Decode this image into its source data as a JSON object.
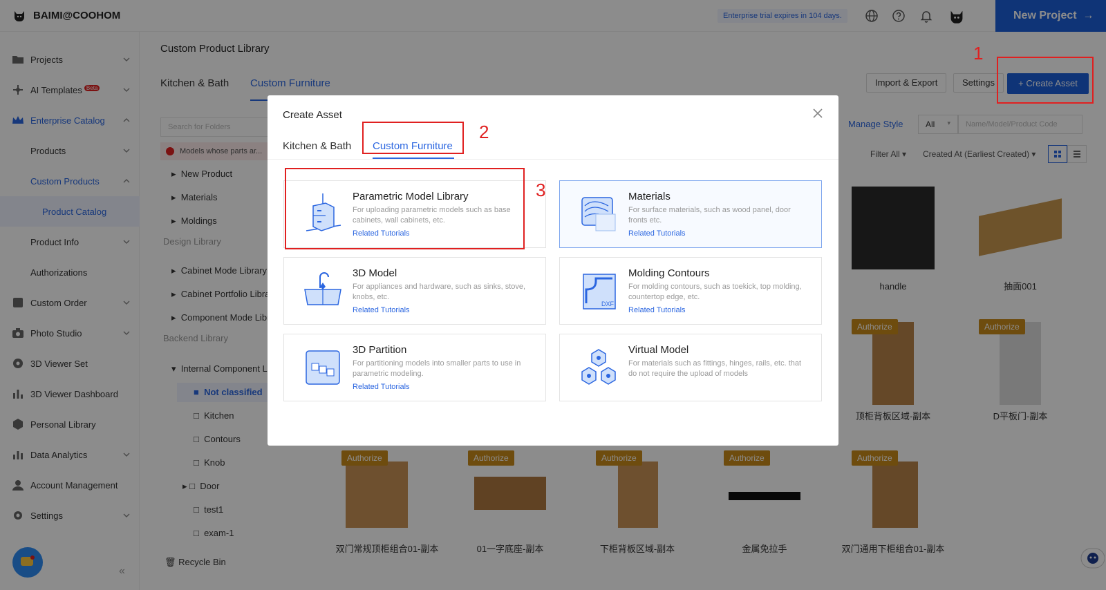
{
  "topbar": {
    "brand": "BAIMI@COOHOM",
    "trial": "Enterprise trial expires in 104 days.",
    "new_project": "New Project"
  },
  "sidebar": {
    "items": [
      {
        "label": "Projects",
        "icon": "folder-icon"
      },
      {
        "label": "AI Templates",
        "badge": "Beta",
        "icon": "ai-icon"
      },
      {
        "label": "Enterprise Catalog",
        "icon": "crown-icon"
      },
      {
        "label": "Products"
      },
      {
        "label": "Custom Products"
      },
      {
        "label": "Product Catalog"
      },
      {
        "label": "Product Info"
      },
      {
        "label": "Authorizations"
      },
      {
        "label": "Custom Order",
        "icon": "order-icon"
      },
      {
        "label": "Photo Studio",
        "icon": "camera-icon"
      },
      {
        "label": "3D Viewer Set",
        "icon": "viewer-icon"
      },
      {
        "label": "3D Viewer Dashboard",
        "icon": "chart-icon"
      },
      {
        "label": "Personal Library",
        "icon": "cube-icon"
      },
      {
        "label": "Data Analytics",
        "icon": "analytics-icon"
      },
      {
        "label": "Account Management",
        "icon": "user-icon"
      },
      {
        "label": "Settings",
        "icon": "gear-icon"
      }
    ]
  },
  "content": {
    "breadcrumb": "Custom Product Library",
    "tabs": [
      "Kitchen & Bath",
      "Custom Furniture"
    ],
    "import_export": "Import & Export",
    "settings": "Settings",
    "create_asset": "+ Create Asset",
    "manage_style": "Manage Style",
    "select_all": "All",
    "search_placeholder": "Name/Model/Product Code",
    "filter_all": "Filter All",
    "created_at": "Created At (Earliest Created)"
  },
  "folders": {
    "search_placeholder": "Search for Folders",
    "warning": "Models whose parts ar...",
    "items": [
      "New Product",
      "Materials",
      "Moldings"
    ],
    "design_library": "Design Library",
    "design_items": [
      "Cabinet Mode Library",
      "Cabinet Portfolio Libra",
      "Component Mode Libr"
    ],
    "backend_library": "Backend Library",
    "backend_root": "Internal Component L",
    "not_classified": "Not classified",
    "backend_items": [
      "Kitchen",
      "Contours",
      "Knob",
      "Door",
      "test1",
      "exam-1"
    ],
    "recycle_bin": "Recycle Bin"
  },
  "products": [
    {
      "name": "handle"
    },
    {
      "name": "抽面001"
    },
    {
      "name": "顶柜背板区域-副本",
      "badge": "Authorize"
    },
    {
      "name": "D平板门-副本",
      "badge": "Authorize"
    },
    {
      "name": "双门常规顶柜组合01-副本",
      "badge": "Authorize"
    },
    {
      "name": "01一字底座-副本",
      "badge": "Authorize"
    },
    {
      "name": "下柜背板区域-副本",
      "badge": "Authorize"
    },
    {
      "name": "金属免拉手",
      "badge": "Authorize"
    },
    {
      "name": "双门通用下柜组合01-副本",
      "badge": "Authorize"
    }
  ],
  "modal": {
    "title": "Create Asset",
    "tabs": [
      "Kitchen & Bath",
      "Custom Furniture"
    ],
    "tiles": [
      {
        "title": "Parametric Model Library",
        "desc": "For uploading parametric models such as base cabinets, wall cabinets, etc.",
        "link": "Related Tutorials",
        "icon": "cabinet-icon"
      },
      {
        "title": "Materials",
        "desc": "For surface materials, such as wood panel, door fronts etc.",
        "link": "Related Tutorials",
        "icon": "materials-icon"
      },
      {
        "title": "3D Model",
        "desc": "For appliances and hardware, such as sinks, stove, knobs, etc.",
        "link": "Related Tutorials",
        "icon": "sink-icon"
      },
      {
        "title": "Molding Contours",
        "desc": "For molding contours, such as toekick, top molding, countertop edge, etc.",
        "link": "Related Tutorials",
        "icon": "dxf-icon",
        "icon_text": "DXF"
      },
      {
        "title": "3D Partition",
        "desc": "For partitioning models into smaller parts to use in parametric modeling.",
        "link": "Related Tutorials",
        "icon": "partition-icon"
      },
      {
        "title": "Virtual Model",
        "desc": "For materials such as fittings, hinges, rails, etc. that do not require the upload of models",
        "icon": "hexagons-icon"
      }
    ]
  },
  "annotations": [
    "1",
    "2",
    "3"
  ],
  "colors": {
    "primary": "#1d5fd9",
    "link": "#2b66e0",
    "annotation": "#e02020",
    "authorize": "#c98a1b"
  }
}
